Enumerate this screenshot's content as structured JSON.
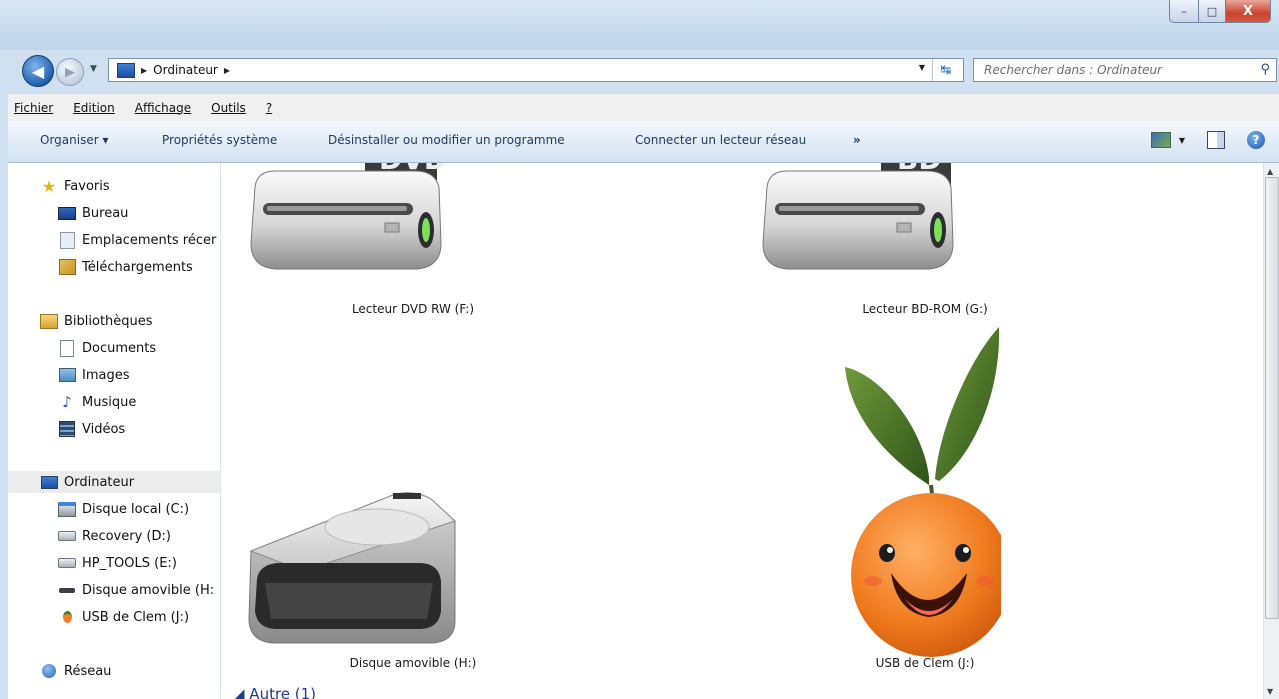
{
  "window": {
    "minimize_glyph": "–",
    "maximize_glyph": "□",
    "close_glyph": "X"
  },
  "address_bar": {
    "crumb": "Ordinateur",
    "search_placeholder": "Rechercher dans : Ordinateur"
  },
  "menu": [
    "Fichier",
    "Edition",
    "Affichage",
    "Outils",
    "?"
  ],
  "toolbar": {
    "organise": "Organiser ▾",
    "system_props": "Propriétés système",
    "uninstall": "Désinstaller ou modifier un programme",
    "map_drive": "Connecter un lecteur réseau",
    "more": "»"
  },
  "sidebar": {
    "favorites": {
      "label": "Favoris",
      "icon": "star-icon",
      "items": [
        {
          "label": "Bureau",
          "icon": "desktop-icon"
        },
        {
          "label": "Emplacements récer",
          "icon": "recent-places-icon"
        },
        {
          "label": "Téléchargements",
          "icon": "downloads-icon"
        }
      ]
    },
    "libraries": {
      "label": "Bibliothèques",
      "icon": "library-icon",
      "items": [
        {
          "label": "Documents",
          "icon": "document-icon"
        },
        {
          "label": "Images",
          "icon": "image-icon"
        },
        {
          "label": "Musique",
          "icon": "music-icon"
        },
        {
          "label": "Vidéos",
          "icon": "video-icon"
        }
      ]
    },
    "computer": {
      "label": "Ordinateur",
      "icon": "computer-icon",
      "items": [
        {
          "label": "Disque local (C:)",
          "icon": "local-disk-icon"
        },
        {
          "label": "Recovery (D:)",
          "icon": "drive-icon"
        },
        {
          "label": "HP_TOOLS (E:)",
          "icon": "drive-icon"
        },
        {
          "label": "Disque amovible (H:",
          "icon": "removable-drive-icon"
        },
        {
          "label": "USB de Clem (J:)",
          "icon": "usb-icon"
        }
      ]
    },
    "network": {
      "label": "Réseau",
      "icon": "network-icon"
    }
  },
  "drives": [
    {
      "label": "Lecteur DVD RW (F:)",
      "icon": "dvd-drive-icon",
      "badge": "DVD"
    },
    {
      "label": "Lecteur BD-ROM (G:)",
      "icon": "bd-drive-icon",
      "badge": "BD"
    },
    {
      "label": "Disque amovible (H:)",
      "icon": "removable-disk-icon"
    },
    {
      "label": "USB de Clem (J:)",
      "icon": "orange-mascot-icon"
    }
  ],
  "other_group": "◢ Autre (1)",
  "colors": {
    "accent": "#1e3d8c",
    "toolbar_text": "#1e395b",
    "close_red": "#c9442d"
  }
}
